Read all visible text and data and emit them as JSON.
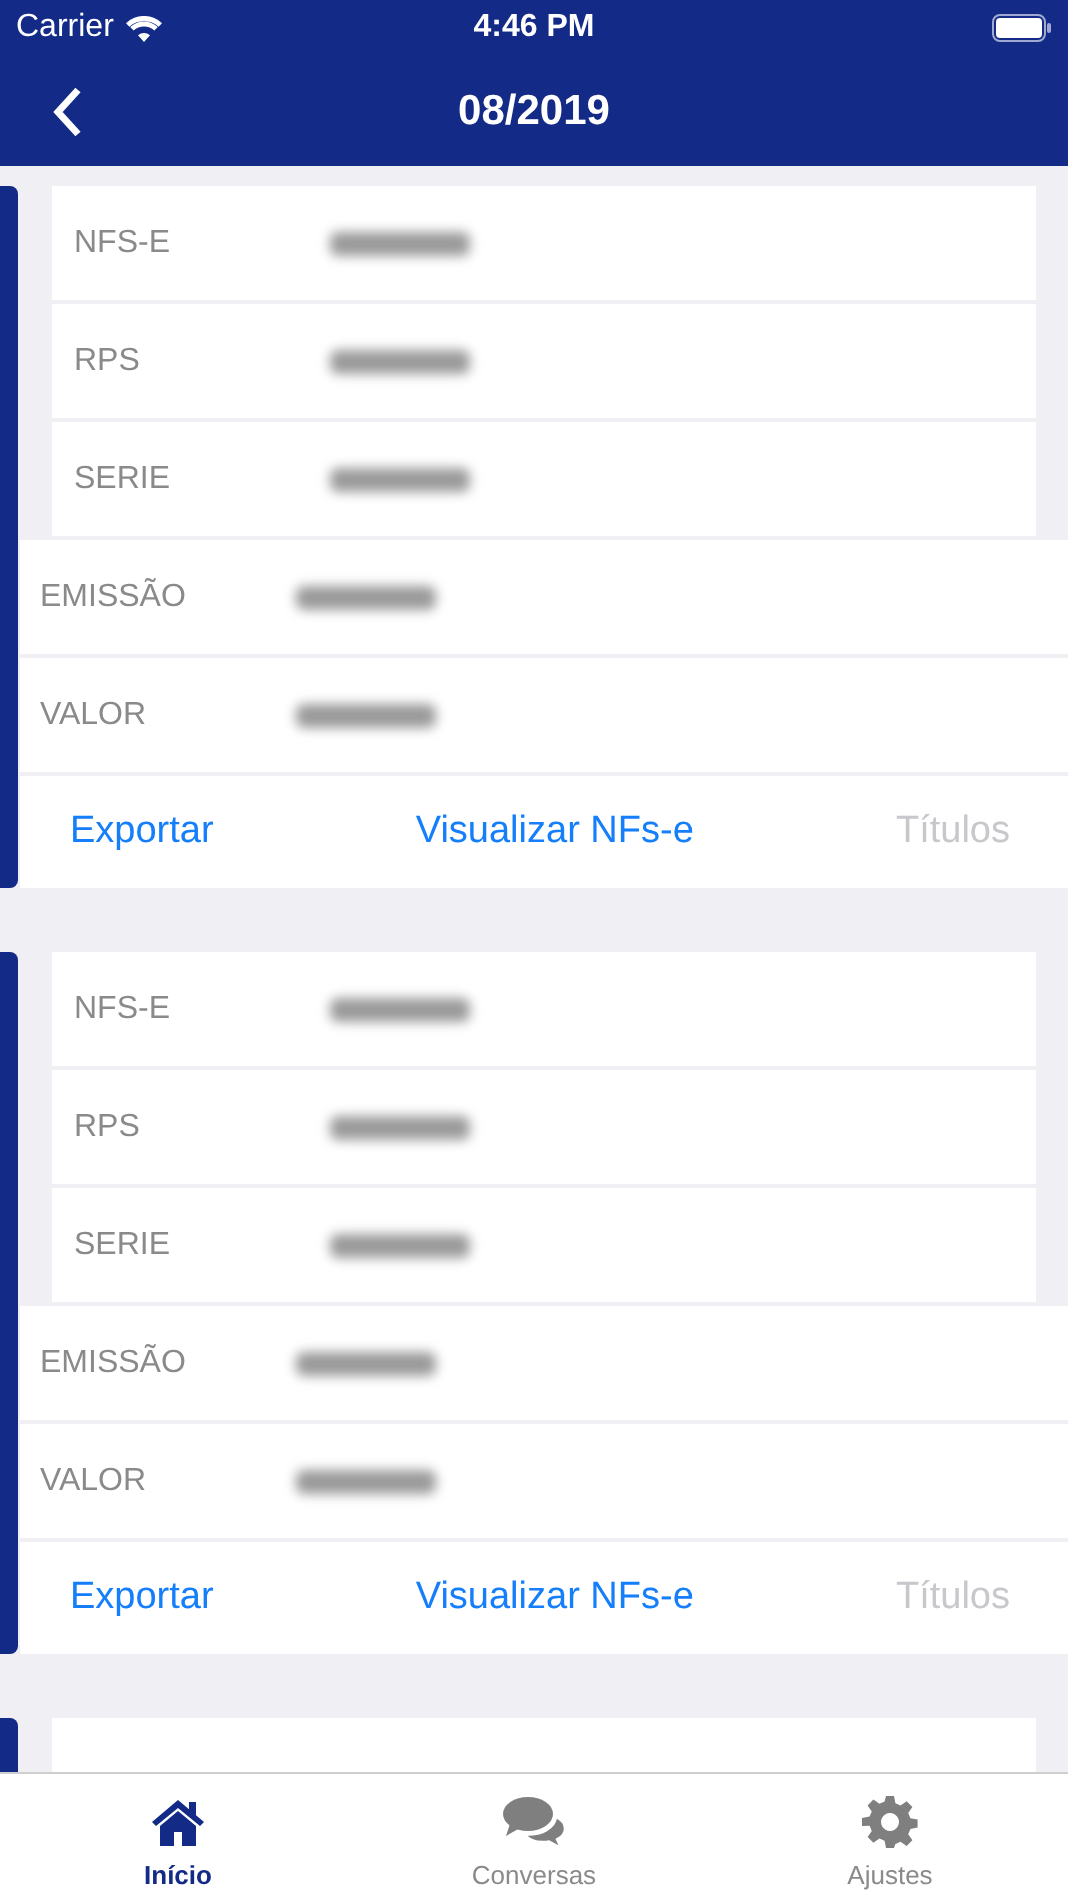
{
  "status_bar": {
    "carrier": "Carrier",
    "time": "4:46 PM"
  },
  "nav_bar": {
    "title": "08/2019"
  },
  "cards": [
    {
      "rows": [
        {
          "kind": "inner",
          "label": "NFS-E",
          "blurred": true
        },
        {
          "kind": "inner",
          "label": "RPS",
          "blurred": true
        },
        {
          "kind": "inner",
          "label": "SERIE",
          "blurred": true
        },
        {
          "kind": "outer",
          "label": "EMISSÃO",
          "blurred": true
        },
        {
          "kind": "outer",
          "label": "VALOR",
          "blurred": true
        }
      ],
      "actions": [
        {
          "label": "Exportar",
          "disabled": false
        },
        {
          "label": "Visualizar NFs-e",
          "disabled": false
        },
        {
          "label": "Títulos",
          "disabled": true
        }
      ]
    },
    {
      "rows": [
        {
          "kind": "inner",
          "label": "NFS-E",
          "blurred": true
        },
        {
          "kind": "inner",
          "label": "RPS",
          "blurred": true
        },
        {
          "kind": "inner",
          "label": "SERIE",
          "blurred": true
        },
        {
          "kind": "outer",
          "label": "EMISSÃO",
          "blurred": true
        },
        {
          "kind": "outer",
          "label": "VALOR",
          "blurred": true
        }
      ],
      "actions": [
        {
          "label": "Exportar",
          "disabled": false
        },
        {
          "label": "Visualizar NFs-e",
          "disabled": false
        },
        {
          "label": "Títulos",
          "disabled": true
        }
      ]
    },
    {
      "rows": [
        {
          "kind": "inner"
        }
      ]
    }
  ],
  "tab_bar": [
    {
      "kind": "home",
      "label": "Início",
      "selected": true
    },
    {
      "kind": "chat",
      "label": "Conversas",
      "selected": false
    },
    {
      "kind": "gear",
      "label": "Ajustes",
      "selected": false
    }
  ]
}
